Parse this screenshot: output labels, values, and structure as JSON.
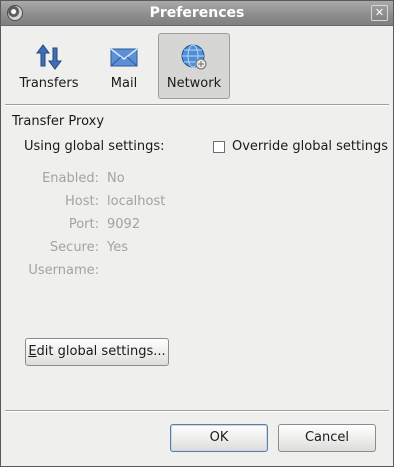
{
  "window": {
    "title": "Preferences",
    "close_glyph": "✕"
  },
  "tabs": [
    {
      "label": "Transfers",
      "icon": "transfers-arrows-icon",
      "active": false
    },
    {
      "label": "Mail",
      "icon": "mail-envelope-icon",
      "active": false
    },
    {
      "label": "Network",
      "icon": "network-globe-icon",
      "active": true
    }
  ],
  "proxy": {
    "section_title": "Transfer Proxy",
    "using_label": "Using global settings:",
    "override_label": "Override global settings",
    "override_checked": false,
    "details": [
      {
        "key": "Enabled:",
        "value": "No"
      },
      {
        "key": "Host:",
        "value": "localhost"
      },
      {
        "key": "Port:",
        "value": "9092"
      },
      {
        "key": "Secure:",
        "value": "Yes"
      },
      {
        "key": "Username:",
        "value": ""
      }
    ],
    "edit_button": {
      "mnemonic": "E",
      "rest": "dit global settings..."
    }
  },
  "footer": {
    "ok_label": "OK",
    "cancel_label": "Cancel"
  },
  "colors": {
    "disabled_text": "#a3a3a3",
    "active_tab_bg": "#d6d6d4",
    "titlebar": "#8e8e8e"
  }
}
